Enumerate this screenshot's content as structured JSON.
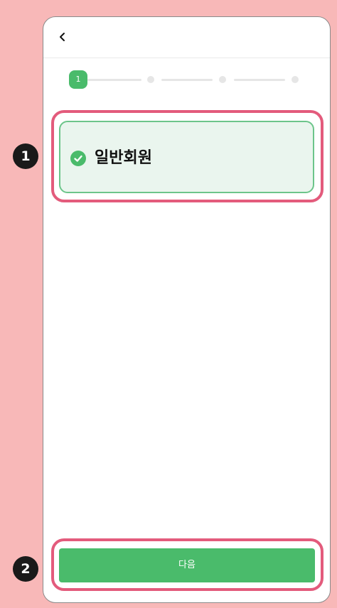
{
  "steps": {
    "current_label": "1"
  },
  "option": {
    "label": "일반회원"
  },
  "next_button": {
    "label": "다음"
  },
  "annotations": [
    {
      "number": "1"
    },
    {
      "number": "2"
    }
  ],
  "colors": {
    "page_background": "#f8b8b8",
    "accent_green": "#4abb6b",
    "selected_card_bg": "#eaf5ee",
    "highlight_pink": "#e35b7c",
    "badge_dark": "#1a1a1a"
  },
  "icons": {
    "back": "chevron-left-icon",
    "selected": "check-circle-icon"
  }
}
